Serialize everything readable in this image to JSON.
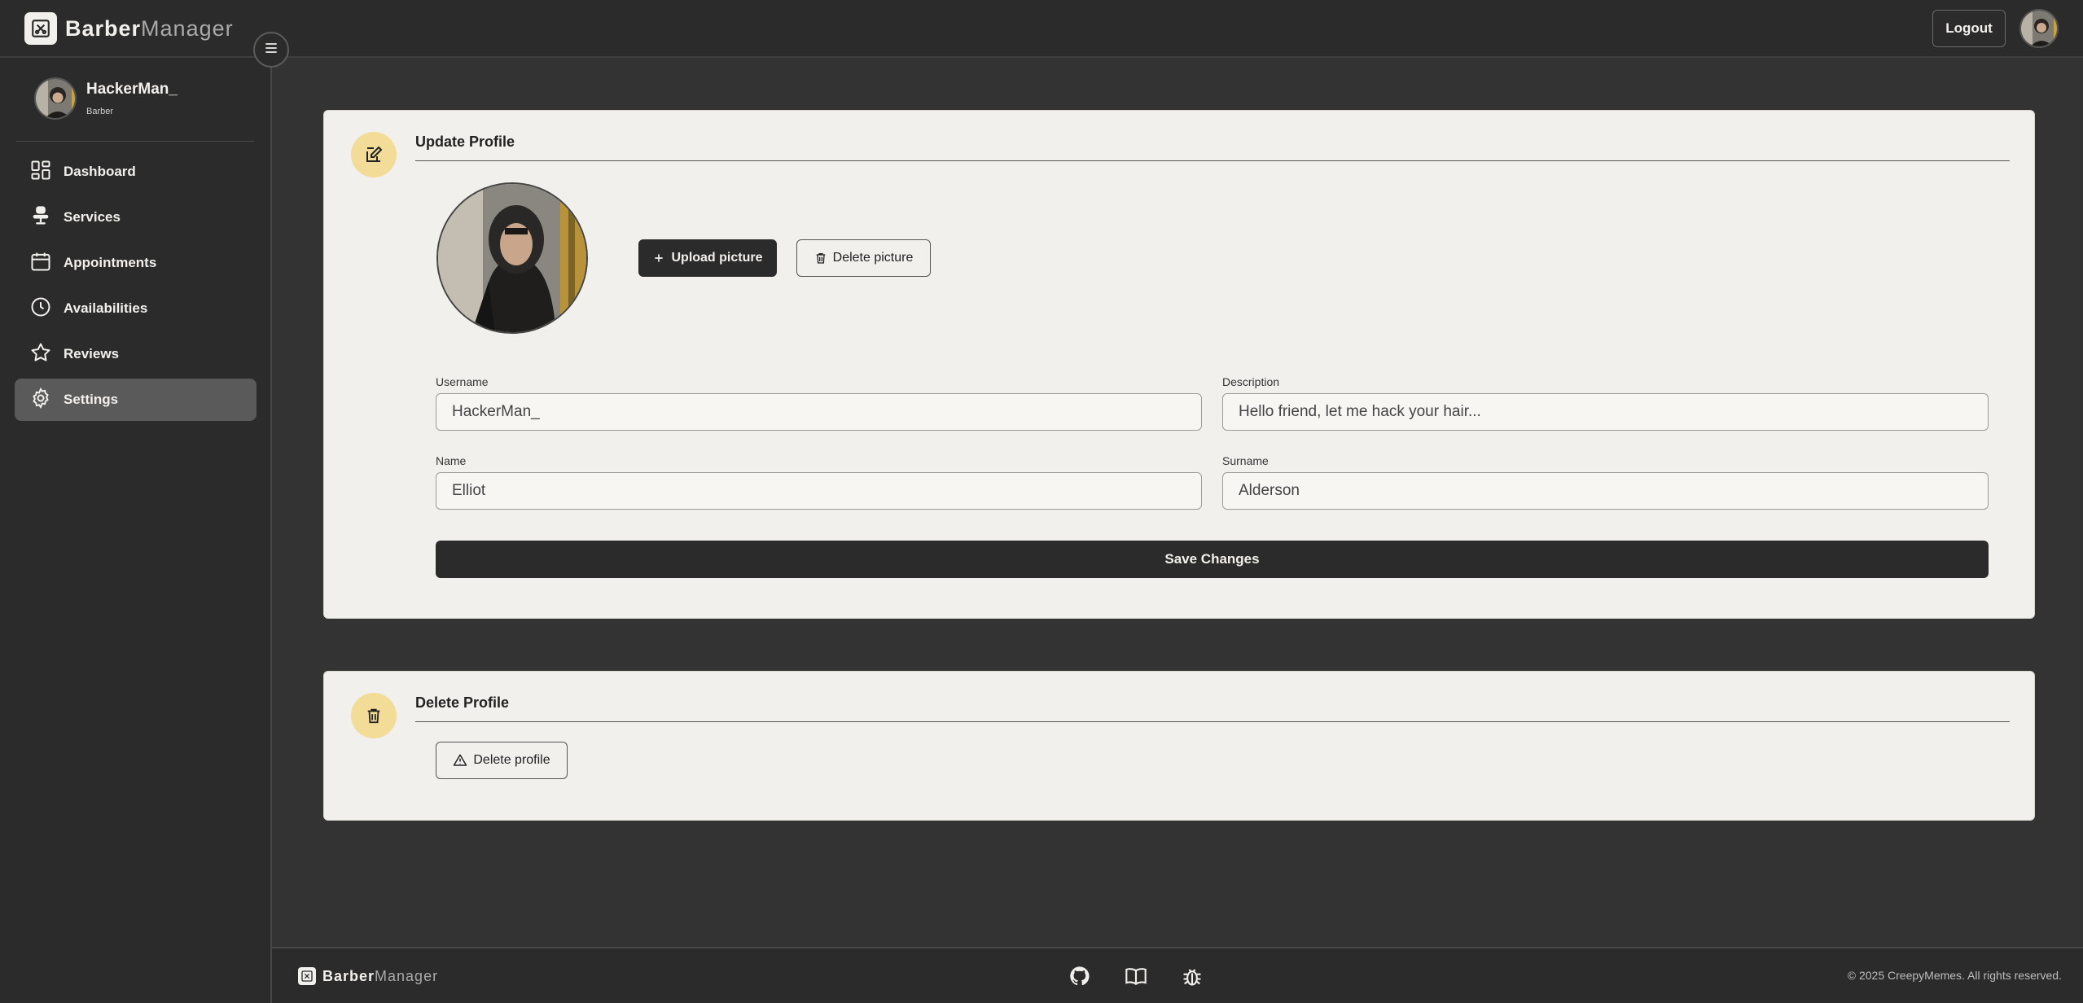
{
  "header": {
    "brand_bold": "Barber",
    "brand_thin": "Manager",
    "logout_label": "Logout"
  },
  "sidebar": {
    "user_name": "HackerMan_",
    "user_role": "Barber",
    "items": [
      {
        "label": "Dashboard",
        "icon": "dashboard-icon"
      },
      {
        "label": "Services",
        "icon": "barber-chair-icon"
      },
      {
        "label": "Appointments",
        "icon": "calendar-icon"
      },
      {
        "label": "Availabilities",
        "icon": "clock-icon"
      },
      {
        "label": "Reviews",
        "icon": "star-icon"
      },
      {
        "label": "Settings",
        "icon": "gear-icon",
        "active": true
      }
    ]
  },
  "update_profile": {
    "title": "Update Profile",
    "upload_label": "Upload picture",
    "delete_picture_label": "Delete picture",
    "username_label": "Username",
    "username_value": "HackerMan_",
    "description_label": "Description",
    "description_value": "Hello friend, let me hack your hair...",
    "name_label": "Name",
    "name_value": "Elliot",
    "surname_label": "Surname",
    "surname_value": "Alderson",
    "save_label": "Save Changes"
  },
  "delete_profile": {
    "title": "Delete Profile",
    "button_label": "Delete profile"
  },
  "footer": {
    "brand_bold": "Barber",
    "brand_thin": "Manager",
    "icons": [
      "github-icon",
      "book-icon",
      "bug-icon"
    ],
    "copyright": "© 2025 CreepyMemes. All rights reserved."
  },
  "colors": {
    "background": "#333333",
    "panel": "#2b2b2b",
    "card": "#f2f0ec",
    "accent": "#f2dc97",
    "active_nav": "#5a5a5a"
  }
}
